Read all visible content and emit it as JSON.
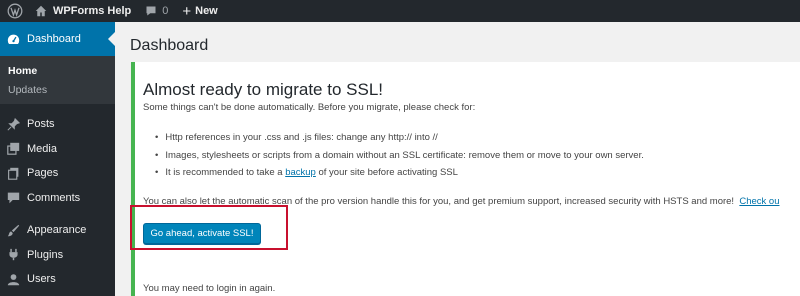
{
  "admin_bar": {
    "site_name": "WPForms Help",
    "comments_count": "0",
    "new_label": "New"
  },
  "sidebar": {
    "dashboard_label": "Dashboard",
    "submenu": [
      {
        "label": "Home"
      },
      {
        "label": "Updates"
      }
    ],
    "items": [
      {
        "label": "Posts",
        "icon": "pin-icon"
      },
      {
        "label": "Media",
        "icon": "media-icon"
      },
      {
        "label": "Pages",
        "icon": "pages-icon"
      },
      {
        "label": "Comments",
        "icon": "comments-icon"
      },
      {
        "label": "Appearance",
        "icon": "brush-icon"
      },
      {
        "label": "Plugins",
        "icon": "plugin-icon"
      },
      {
        "label": "Users",
        "icon": "user-icon"
      }
    ]
  },
  "main": {
    "page_title": "Dashboard",
    "notice": {
      "heading": "Almost ready to migrate to SSL!",
      "intro": "Some things can't be done automatically. Before you migrate, please check for:",
      "checks": [
        "Http references in your .css and .js files: change any http:// into //",
        "Images, stylesheets or scripts from a domain without an SSL certificate: remove them or move to your own server."
      ],
      "backup_before": "It is recommended to take a",
      "backup_link": "backup",
      "backup_after": "of your site before activating SSL",
      "pro_text": "You can also let the automatic scan of the pro version handle this for you, and get premium support, increased security with HSTS and more!",
      "pro_link": "Check ou",
      "button_label": "Go ahead, activate SSL!",
      "login_note": "You may need to login in again."
    }
  },
  "colors": {
    "admin_dark": "#23282d",
    "accent_blue": "#0073aa",
    "notice_green": "#46b450",
    "highlight_red": "#c8102e"
  }
}
